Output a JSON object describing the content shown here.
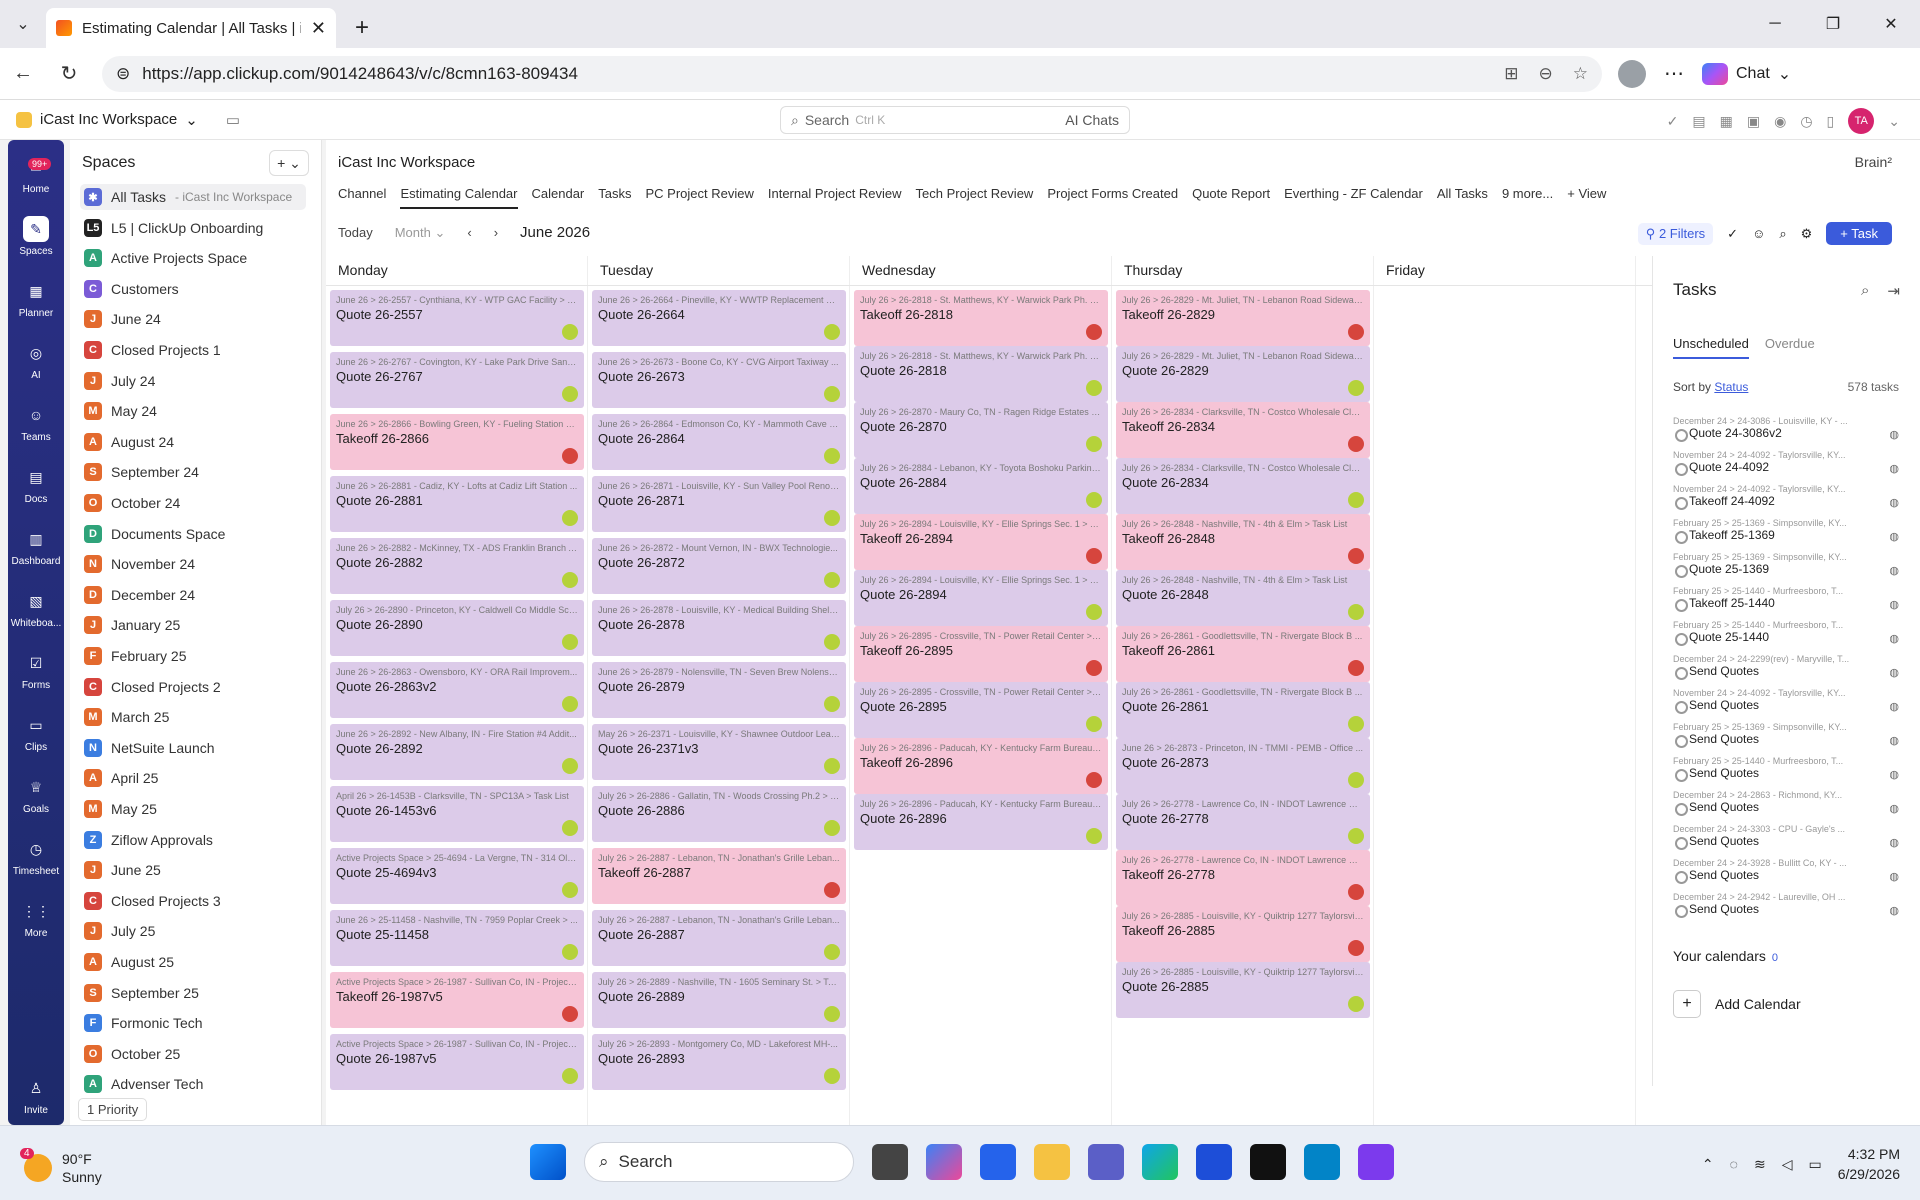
{
  "browser": {
    "tab_title": "Estimating Calendar | All Tasks | iC",
    "url": "https://app.clickup.com/9014248643/v/c/8cmn163-809434",
    "chat_label": "Chat"
  },
  "app": {
    "workspace": "iCast Inc Workspace",
    "search_label": "Search",
    "search_shortcut": "Ctrl K",
    "ai_chats": "AI Chats",
    "user_initials": "TA",
    "brain": "Brain²"
  },
  "rail": [
    {
      "label": "Home",
      "badge": "99+"
    },
    {
      "label": "Spaces"
    },
    {
      "label": "Planner"
    },
    {
      "label": "AI"
    },
    {
      "label": "Teams"
    },
    {
      "label": "Docs"
    },
    {
      "label": "Dashboard"
    },
    {
      "label": "Whiteboa..."
    },
    {
      "label": "Forms"
    },
    {
      "label": "Clips"
    },
    {
      "label": "Goals"
    },
    {
      "label": "Timesheet"
    },
    {
      "label": "More"
    },
    {
      "label": "Invite"
    }
  ],
  "spaces": {
    "title": "Spaces",
    "items": [
      {
        "icon": "✱",
        "label": "All Tasks",
        "sub": "- iCast Inc Workspace",
        "color": "#5b6bd6"
      },
      {
        "icon": "L5",
        "label": "L5 | ClickUp Onboarding",
        "color": "#222222"
      },
      {
        "icon": "A",
        "label": "Active Projects Space",
        "color": "#2fa37a"
      },
      {
        "icon": "C",
        "label": "Customers",
        "color": "#7b5bd6"
      },
      {
        "icon": "J",
        "label": "June 24",
        "color": "#e36a2e"
      },
      {
        "icon": "C",
        "label": "Closed Projects 1",
        "color": "#d6453d"
      },
      {
        "icon": "J",
        "label": "July 24",
        "color": "#e36a2e"
      },
      {
        "icon": "M",
        "label": "May 24",
        "color": "#e36a2e"
      },
      {
        "icon": "A",
        "label": "August 24",
        "color": "#e36a2e"
      },
      {
        "icon": "S",
        "label": "September 24",
        "color": "#e36a2e"
      },
      {
        "icon": "O",
        "label": "October 24",
        "color": "#e36a2e"
      },
      {
        "icon": "D",
        "label": "Documents Space",
        "color": "#2fa37a"
      },
      {
        "icon": "N",
        "label": "November 24",
        "color": "#e36a2e"
      },
      {
        "icon": "D",
        "label": "December 24",
        "color": "#e36a2e"
      },
      {
        "icon": "J",
        "label": "January 25",
        "color": "#e36a2e"
      },
      {
        "icon": "F",
        "label": "February 25",
        "color": "#e36a2e"
      },
      {
        "icon": "C",
        "label": "Closed Projects 2",
        "color": "#d6453d"
      },
      {
        "icon": "M",
        "label": "March 25",
        "color": "#e36a2e"
      },
      {
        "icon": "N",
        "label": "NetSuite Launch",
        "color": "#3b7de0"
      },
      {
        "icon": "A",
        "label": "April 25",
        "color": "#e36a2e"
      },
      {
        "icon": "M",
        "label": "May 25",
        "color": "#e36a2e"
      },
      {
        "icon": "Z",
        "label": "Ziflow Approvals",
        "color": "#3b7de0"
      },
      {
        "icon": "J",
        "label": "June 25",
        "color": "#e36a2e"
      },
      {
        "icon": "C",
        "label": "Closed Projects 3",
        "color": "#d6453d"
      },
      {
        "icon": "J",
        "label": "July 25",
        "color": "#e36a2e"
      },
      {
        "icon": "A",
        "label": "August 25",
        "color": "#e36a2e"
      },
      {
        "icon": "S",
        "label": "September 25",
        "color": "#e36a2e"
      },
      {
        "icon": "F",
        "label": "Formonic Tech",
        "color": "#3b7de0"
      },
      {
        "icon": "O",
        "label": "October 25",
        "color": "#e36a2e"
      },
      {
        "icon": "A",
        "label": "Advenser Tech",
        "color": "#2fa37a"
      }
    ],
    "priority": "1 Priority"
  },
  "main": {
    "workspace": "iCast Inc Workspace",
    "views": [
      "Channel",
      "Estimating Calendar",
      "Calendar",
      "Tasks",
      "PC Project Review",
      "Internal Project Review",
      "Tech Project Review",
      "Project Forms Created",
      "Quote Report",
      "Everthing - ZF Calendar",
      "All Tasks",
      "9 more...",
      "+ View"
    ],
    "today": "Today",
    "month": "Month",
    "date": "June 2026",
    "filters": "2 Filters",
    "task_btn": "+ Task",
    "days": [
      "Monday",
      "Tuesday",
      "Wednesday",
      "Thursday",
      "Friday"
    ]
  },
  "calendar": [
    [
      {
        "path": "June 26 > 26-2557 - Cynthiana, KY - WTP GAC Facility > Task List",
        "name": "Quote 26-2557",
        "kind": "quote"
      },
      {
        "path": "June 26 > 26-2767 - Covington, KY - Lake Park Drive Sanit...",
        "name": "Quote 26-2767",
        "kind": "quote"
      },
      {
        "path": "June 26 > 26-2866 - Bowling Green, KY - Fueling Station at...",
        "name": "Takeoff 26-2866",
        "kind": "takeoff"
      },
      {
        "path": "June 26 > 26-2881 - Cadiz, KY - Lofts at Cadiz Lift Station ...",
        "name": "Quote 26-2881",
        "kind": "quote"
      },
      {
        "path": "June 26 > 26-2882 - McKinney, TX - ADS Franklin Branch A...",
        "name": "Quote 26-2882",
        "kind": "quote"
      },
      {
        "path": "July 26 > 26-2890 - Princeton, KY - Caldwell Co Middle Sch...",
        "name": "Quote 26-2890",
        "kind": "quote"
      },
      {
        "path": "June 26 > 26-2863 - Owensboro, KY - ORA Rail Improvem...",
        "name": "Quote 26-2863v2",
        "kind": "quote"
      },
      {
        "path": "June 26 > 26-2892 - New Albany, IN - Fire Station #4 Addit...",
        "name": "Quote 26-2892",
        "kind": "quote"
      },
      {
        "path": "April 26 > 26-1453B - Clarksville, TN - SPC13A > Task List",
        "name": "Quote 26-1453v6",
        "kind": "quote"
      },
      {
        "path": "Active Projects Space > 25-4694 - La Vergne, TN - 314 Old ...",
        "name": "Quote 25-4694v3",
        "kind": "quote"
      },
      {
        "path": "June 26 > 25-11458 - Nashville, TN - 7959 Poplar Creek > ...",
        "name": "Quote 25-11458",
        "kind": "quote"
      },
      {
        "path": "Active Projects Space > 26-1987 - Sullivan Co, IN - Project ...",
        "name": "Takeoff 26-1987v5",
        "kind": "takeoff"
      },
      {
        "path": "Active Projects Space > 26-1987 - Sullivan Co, IN - Project ...",
        "name": "Quote 26-1987v5",
        "kind": "quote"
      }
    ],
    [
      {
        "path": "June 26 > 26-2664 - Pineville, KY - WWTP Replacement Bel...",
        "name": "Quote 26-2664",
        "kind": "quote"
      },
      {
        "path": "June 26 > 26-2673 - Boone Co, KY - CVG Airport Taxiway ...",
        "name": "Quote 26-2673",
        "kind": "quote"
      },
      {
        "path": "June 26 > 26-2864 - Edmonson Co, KY - Mammoth Cave P...",
        "name": "Quote 26-2864",
        "kind": "quote"
      },
      {
        "path": "June 26 > 26-2871 - Louisville, KY - Sun Valley Pool Renova...",
        "name": "Quote 26-2871",
        "kind": "quote"
      },
      {
        "path": "June 26 > 26-2872 - Mount Vernon, IN - BWX Technologie...",
        "name": "Quote 26-2872",
        "kind": "quote"
      },
      {
        "path": "June 26 > 26-2878 - Louisville, KY - Medical Building Shell ...",
        "name": "Quote 26-2878",
        "kind": "quote"
      },
      {
        "path": "June 26 > 26-2879 - Nolensville, TN - Seven Brew Nolensvi...",
        "name": "Quote 26-2879",
        "kind": "quote"
      },
      {
        "path": "May 26 > 26-2371 - Louisville, KY - Shawnee Outdoor Lear...",
        "name": "Quote 26-2371v3",
        "kind": "quote"
      },
      {
        "path": "July 26 > 26-2886 - Gallatin, TN - Woods Crossing Ph.2 > T...",
        "name": "Quote 26-2886",
        "kind": "quote"
      },
      {
        "path": "July 26 > 26-2887 - Lebanon, TN - Jonathan's Grille Leban...",
        "name": "Takeoff 26-2887",
        "kind": "takeoff"
      },
      {
        "path": "July 26 > 26-2887 - Lebanon, TN - Jonathan's Grille Leban...",
        "name": "Quote 26-2887",
        "kind": "quote"
      },
      {
        "path": "July 26 > 26-2889 - Nashville, TN - 1605 Seminary St. > Tas...",
        "name": "Quote 26-2889",
        "kind": "quote"
      },
      {
        "path": "July 26 > 26-2893 - Montgomery Co, MD - Lakeforest MH-...",
        "name": "Quote 26-2893",
        "kind": "quote"
      }
    ],
    [
      {
        "path": "July 26 > 26-2818 - St. Matthews, KY - Warwick Park Ph. 2 ...",
        "name": "Takeoff 26-2818",
        "kind": "takeoff"
      },
      {
        "path": "July 26 > 26-2818 - St. Matthews, KY - Warwick Park Ph. 2 ...",
        "name": "Quote 26-2818",
        "kind": "quote"
      },
      {
        "path": "July 26 > 26-2870 - Maury Co, TN - Ragen Ridge Estates > ...",
        "name": "Quote 26-2870",
        "kind": "quote"
      },
      {
        "path": "July 26 > 26-2884 - Lebanon, KY - Toyota Boshoku Parking...",
        "name": "Quote 26-2884",
        "kind": "quote"
      },
      {
        "path": "July 26 > 26-2894 - Louisville, KY - Ellie Springs Sec. 1 > Ta...",
        "name": "Takeoff 26-2894",
        "kind": "takeoff"
      },
      {
        "path": "July 26 > 26-2894 - Louisville, KY - Ellie Springs Sec. 1 > Ta...",
        "name": "Quote 26-2894",
        "kind": "quote"
      },
      {
        "path": "July 26 > 26-2895 - Crossville, TN - Power Retail Center > T...",
        "name": "Takeoff 26-2895",
        "kind": "takeoff"
      },
      {
        "path": "July 26 > 26-2895 - Crossville, TN - Power Retail Center > T...",
        "name": "Quote 26-2895",
        "kind": "quote"
      },
      {
        "path": "July 26 > 26-2896 - Paducah, KY - Kentucky Farm Bureau L...",
        "name": "Takeoff 26-2896",
        "kind": "takeoff"
      },
      {
        "path": "July 26 > 26-2896 - Paducah, KY - Kentucky Farm Bureau L...",
        "name": "Quote 26-2896",
        "kind": "quote"
      }
    ],
    [
      {
        "path": "July 26 > 26-2829 - Mt. Juliet, TN - Lebanon Road Sidewalk...",
        "name": "Takeoff 26-2829",
        "kind": "takeoff"
      },
      {
        "path": "July 26 > 26-2829 - Mt. Juliet, TN - Lebanon Road Sidewalk...",
        "name": "Quote 26-2829",
        "kind": "quote"
      },
      {
        "path": "July 26 > 26-2834 - Clarksville, TN - Costco Wholesale Clar...",
        "name": "Takeoff 26-2834",
        "kind": "takeoff"
      },
      {
        "path": "July 26 > 26-2834 - Clarksville, TN - Costco Wholesale Clar...",
        "name": "Quote 26-2834",
        "kind": "quote"
      },
      {
        "path": "July 26 > 26-2848 - Nashville, TN - 4th & Elm > Task List",
        "name": "Takeoff 26-2848",
        "kind": "takeoff"
      },
      {
        "path": "July 26 > 26-2848 - Nashville, TN - 4th & Elm > Task List",
        "name": "Quote 26-2848",
        "kind": "quote"
      },
      {
        "path": "July 26 > 26-2861 - Goodlettsville, TN - Rivergate Block B ...",
        "name": "Takeoff 26-2861",
        "kind": "takeoff"
      },
      {
        "path": "July 26 > 26-2861 - Goodlettsville, TN - Rivergate Block B ...",
        "name": "Quote 26-2861",
        "kind": "quote"
      },
      {
        "path": "June 26 > 26-2873 - Princeton, IN - TMMI - PEMB - Office ...",
        "name": "Quote 26-2873",
        "kind": "quote"
      },
      {
        "path": "July 26 > 26-2778 - Lawrence Co, IN - INDOT Lawrence Co ...",
        "name": "Quote 26-2778",
        "kind": "quote"
      },
      {
        "path": "July 26 > 26-2778 - Lawrence Co, IN - INDOT Lawrence Co ...",
        "name": "Takeoff 26-2778",
        "kind": "takeoff"
      },
      {
        "path": "July 26 > 26-2885 - Louisville, KY - Quiktrip 1277 Taylorsvill...",
        "name": "Takeoff 26-2885",
        "kind": "takeoff"
      },
      {
        "path": "July 26 > 26-2885 - Louisville, KY - Quiktrip 1277 Taylorsvill...",
        "name": "Quote 26-2885",
        "kind": "quote"
      }
    ],
    []
  ],
  "right_panel": {
    "title": "Tasks",
    "tab_unscheduled": "Unscheduled",
    "tab_overdue": "Overdue",
    "sort_label": "Sort by",
    "sort_field": "Status",
    "count": "578 tasks",
    "tasks": [
      {
        "path": "December 24 > 24-3086 - Louisville, KY - ...",
        "name": "Quote 24-3086v2"
      },
      {
        "path": "November 24 > 24-4092 - Taylorsville, KY...",
        "name": "Quote 24-4092"
      },
      {
        "path": "November 24 > 24-4092 - Taylorsville, KY...",
        "name": "Takeoff 24-4092"
      },
      {
        "path": "February 25 > 25-1369 - Simpsonville, KY...",
        "name": "Takeoff 25-1369"
      },
      {
        "path": "February 25 > 25-1369 - Simpsonville, KY...",
        "name": "Quote 25-1369"
      },
      {
        "path": "February 25 > 25-1440 - Murfreesboro, T...",
        "name": "Takeoff 25-1440"
      },
      {
        "path": "February 25 > 25-1440 - Murfreesboro, T...",
        "name": "Quote 25-1440"
      },
      {
        "path": "December 24 > 24-2299(rev) - Maryville, T...",
        "name": "Send Quotes"
      },
      {
        "path": "November 24 > 24-4092 - Taylorsville, KY...",
        "name": "Send Quotes"
      },
      {
        "path": "February 25 > 25-1369 - Simpsonville, KY...",
        "name": "Send Quotes"
      },
      {
        "path": "February 25 > 25-1440 - Murfreesboro, T...",
        "name": "Send Quotes"
      },
      {
        "path": "December 24 > 24-2863 - Richmond, KY...",
        "name": "Send Quotes"
      },
      {
        "path": "December 24 > 24-3303 - CPU - Gayle's ...",
        "name": "Send Quotes"
      },
      {
        "path": "December 24 > 24-3928 - Bullitt Co, KY - ...",
        "name": "Send Quotes"
      },
      {
        "path": "December 24 > 24-2942 - Laureville, OH ...",
        "name": "Send Quotes"
      }
    ],
    "your_calendars": "Your calendars",
    "cal_count": "0",
    "add_calendar": "Add Calendar"
  },
  "taskbar": {
    "weather_badge": "4",
    "temp": "90°F",
    "cond": "Sunny",
    "search": "Search",
    "time": "4:32 PM",
    "date": "6/29/2026"
  }
}
